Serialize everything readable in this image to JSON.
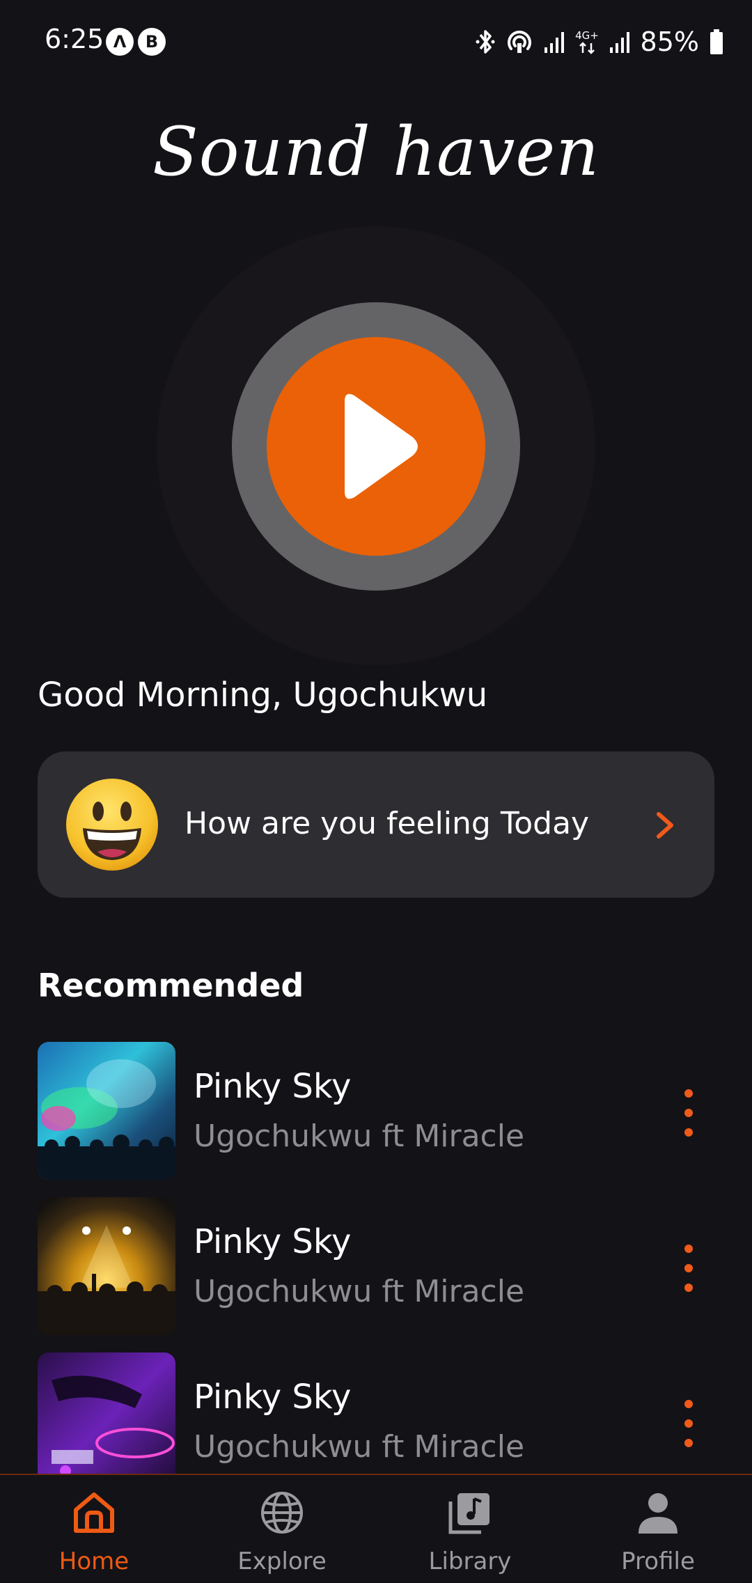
{
  "status_bar": {
    "time": "6:25",
    "app_badges": [
      "Λ",
      "B"
    ],
    "network": "4G+",
    "battery": "85%"
  },
  "app": {
    "title": "Sound haven",
    "accent_color": "#ea6107"
  },
  "greeting": "Good Morning, Ugochukwu",
  "mood_card": {
    "text": "How are you feeling Today",
    "emoji_icon": "grinning-face-emoji"
  },
  "recommended": {
    "title": "Recommended",
    "tracks": [
      {
        "title": "Pinky Sky",
        "artist": "Ugochukwu ft Miracle",
        "art": "concert-confetti"
      },
      {
        "title": "Pinky Sky",
        "artist": "Ugochukwu ft Miracle",
        "art": "concert-stage-lights"
      },
      {
        "title": "Pinky Sky",
        "artist": "Ugochukwu ft Miracle",
        "art": "dj-turntable"
      }
    ]
  },
  "bottom_nav": {
    "items": [
      {
        "label": "Home",
        "icon": "home-icon",
        "active": true
      },
      {
        "label": "Explore",
        "icon": "globe-icon",
        "active": false
      },
      {
        "label": "Library",
        "icon": "music-library-icon",
        "active": false
      },
      {
        "label": "Profile",
        "icon": "person-icon",
        "active": false
      }
    ]
  }
}
